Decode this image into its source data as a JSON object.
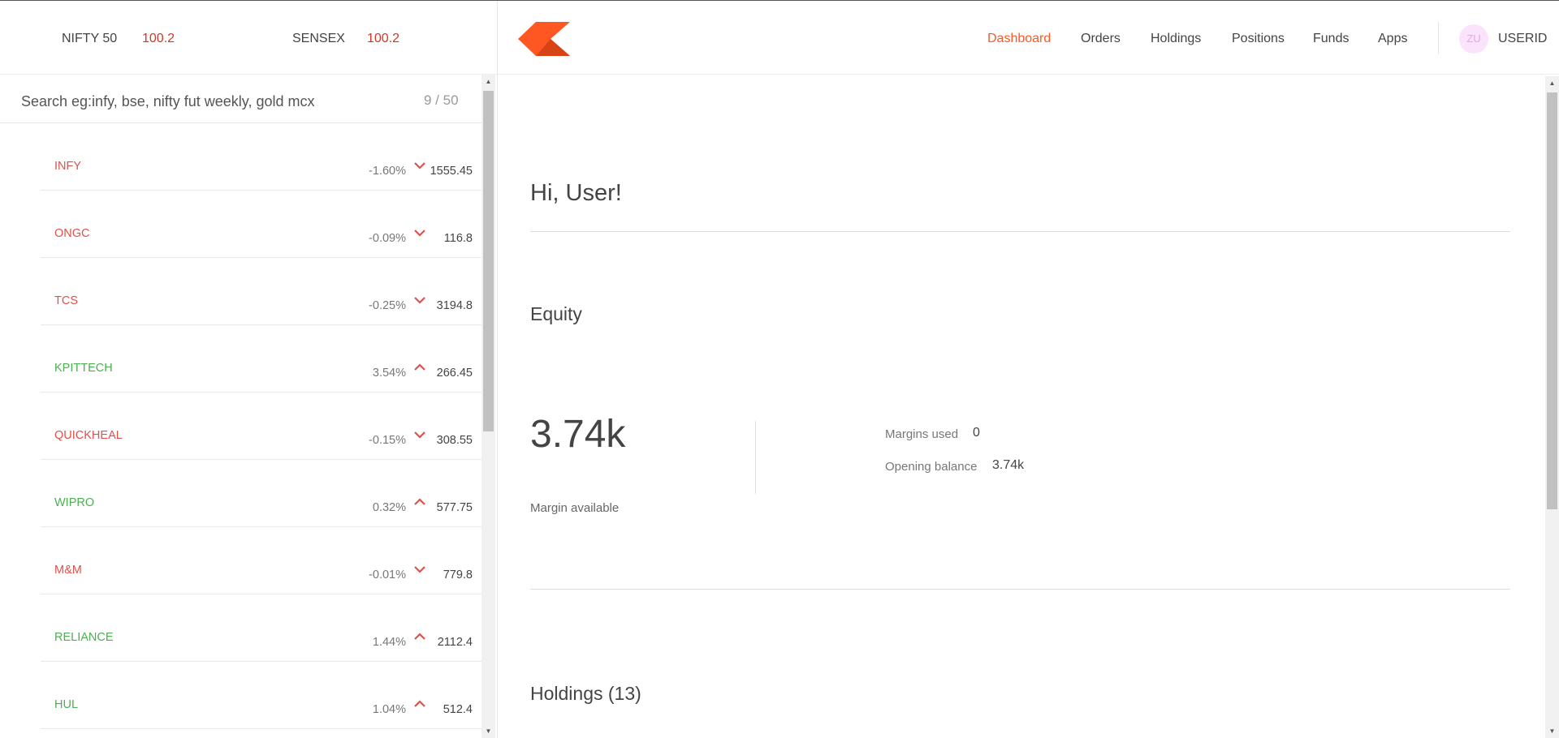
{
  "indices": {
    "nifty": {
      "name": "NIFTY 50",
      "value": "100.2"
    },
    "sensex": {
      "name": "SENSEX",
      "value": "100.2"
    }
  },
  "brand": {
    "logo_color": "#ff5722",
    "logo_dark_color": "#d84315"
  },
  "nav": {
    "items": [
      {
        "label": "Dashboard",
        "active": true
      },
      {
        "label": "Orders"
      },
      {
        "label": "Holdings"
      },
      {
        "label": "Positions"
      },
      {
        "label": "Funds"
      },
      {
        "label": "Apps"
      }
    ],
    "avatar_initials": "ZU",
    "user_id": "USERID"
  },
  "marketwatch": {
    "search_placeholder": "Search eg:infy, bse, nifty fut weekly, gold mcx",
    "count": "9 / 50",
    "items": [
      {
        "symbol": "INFY",
        "change": "-1.60%",
        "direction": "down",
        "price": "1555.45"
      },
      {
        "symbol": "ONGC",
        "change": "-0.09%",
        "direction": "down",
        "price": "116.8"
      },
      {
        "symbol": "TCS",
        "change": "-0.25%",
        "direction": "down",
        "price": "3194.8"
      },
      {
        "symbol": "KPITTECH",
        "change": "3.54%",
        "direction": "up",
        "price": "266.45"
      },
      {
        "symbol": "QUICKHEAL",
        "change": "-0.15%",
        "direction": "down",
        "price": "308.55"
      },
      {
        "symbol": "WIPRO",
        "change": "0.32%",
        "direction": "up",
        "price": "577.75"
      },
      {
        "symbol": "M&M",
        "change": "-0.01%",
        "direction": "down",
        "price": "779.8"
      },
      {
        "symbol": "RELIANCE",
        "change": "1.44%",
        "direction": "up",
        "price": "2112.4"
      },
      {
        "symbol": "HUL",
        "change": "1.04%",
        "direction": "up",
        "price": "512.4"
      }
    ],
    "colors": {
      "down": "#df514c",
      "up": "#4caf50",
      "arrow": "#df514c"
    }
  },
  "dashboard": {
    "greeting": "Hi, User!",
    "equity": {
      "heading": "Equity",
      "margin_available_value": "3.74k",
      "margin_available_label": "Margin available",
      "margins_used_label": "Margins used",
      "margins_used_value": "0",
      "opening_balance_label": "Opening balance",
      "opening_balance_value": "3.74k"
    },
    "holdings_heading": "Holdings (13)"
  }
}
